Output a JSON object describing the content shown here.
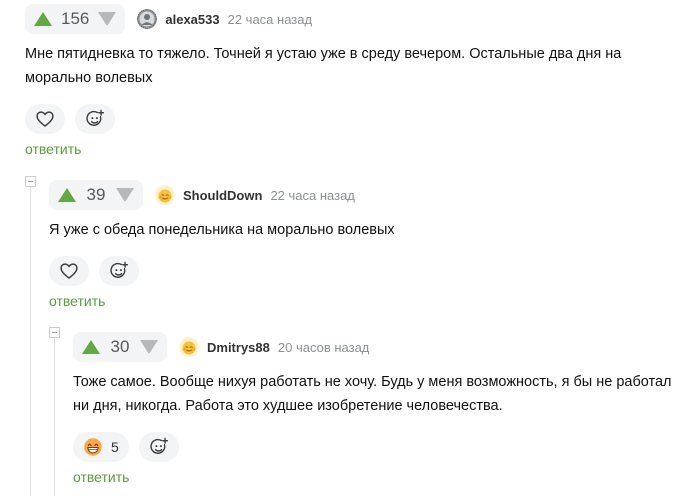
{
  "colors": {
    "vote_up": "#62a844",
    "vote_down": "#b5b9bc",
    "reply": "#589d3a",
    "thread_line": "#dcdfe1"
  },
  "comments": [
    {
      "rating": "156",
      "username": "alexa533",
      "time": "22 часа назад",
      "text": "Мне пятидневка то тяжело. Точней я устаю уже в среду вечером. Остальные два дня на морально волевых",
      "reply_label": "ответить",
      "avatar_icon": "grayscale-avatar-icon",
      "actions": [
        {
          "icon": "heart-icon"
        },
        {
          "icon": "add-reaction-icon"
        }
      ]
    },
    {
      "rating": "39",
      "username": "ShouldDown",
      "time": "22 часа назад",
      "text": "Я уже с обеда понедельника на морально волевых",
      "reply_label": "ответить",
      "avatar_icon": "yellow-face-avatar-icon",
      "actions": [
        {
          "icon": "heart-icon"
        },
        {
          "icon": "add-reaction-icon"
        }
      ]
    },
    {
      "rating": "30",
      "username": "Dmitrys88",
      "time": "20 часов назад",
      "text": "Тоже самое. Вообще нихуя работать не хочу. Будь у меня возможность, я бы не работал ни дня, никогда. Работа это худшее изобретение человечества.",
      "reply_label": "ответить",
      "avatar_icon": "yellow-face-avatar-icon",
      "actions": [
        {
          "icon": "grinning-face-reaction-icon",
          "count": "5"
        },
        {
          "icon": "add-reaction-icon"
        }
      ]
    }
  ]
}
